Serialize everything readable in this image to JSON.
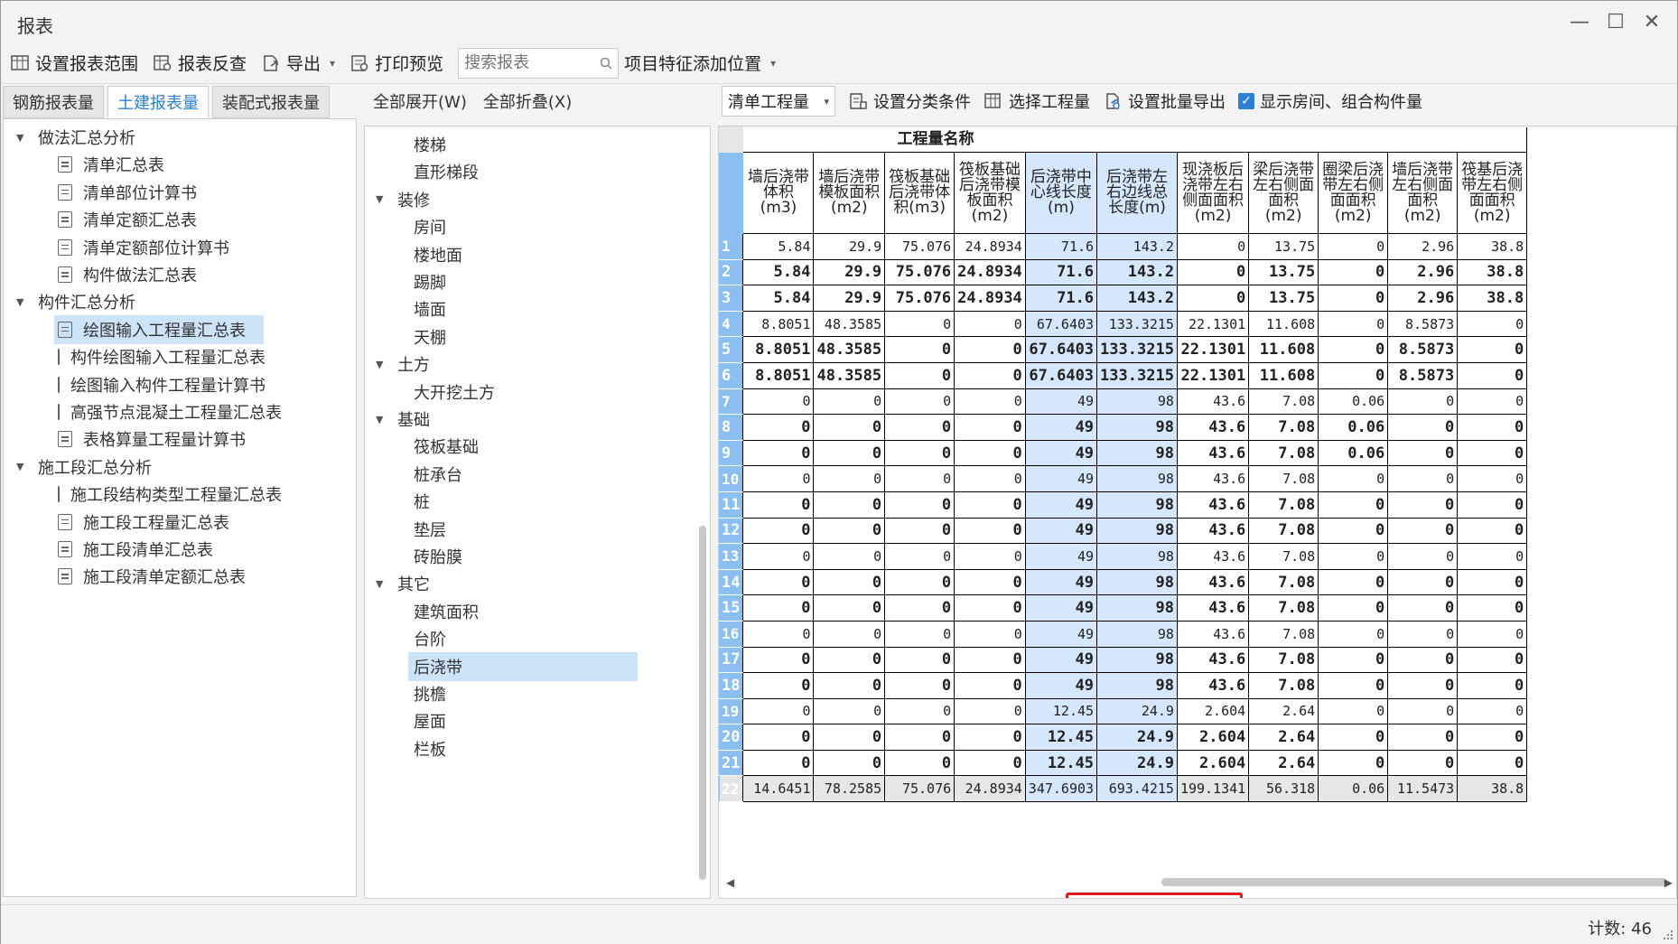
{
  "window": {
    "title": "报表"
  },
  "toolbar": {
    "set_range": "设置报表范围",
    "reverse_check": "报表反查",
    "export": "导出",
    "print_preview": "打印预览",
    "search_placeholder": "搜索报表",
    "feature_position": "项目特征添加位置"
  },
  "left": {
    "tabs": [
      "钢筋报表量",
      "土建报表量",
      "装配式报表量"
    ],
    "active_tab": 1,
    "tree": [
      {
        "label": "做法汇总分析",
        "level": 0,
        "type": "group"
      },
      {
        "label": "清单汇总表",
        "level": 1,
        "type": "doc"
      },
      {
        "label": "清单部位计算书",
        "level": 1,
        "type": "doc"
      },
      {
        "label": "清单定额汇总表",
        "level": 1,
        "type": "doc"
      },
      {
        "label": "清单定额部位计算书",
        "level": 1,
        "type": "doc"
      },
      {
        "label": "构件做法汇总表",
        "level": 1,
        "type": "doc"
      },
      {
        "label": "构件汇总分析",
        "level": 0,
        "type": "group"
      },
      {
        "label": "绘图输入工程量汇总表",
        "level": 1,
        "type": "doc",
        "selected": true
      },
      {
        "label": "构件绘图输入工程量汇总表",
        "level": 1,
        "type": "doc"
      },
      {
        "label": "绘图输入构件工程量计算书",
        "level": 1,
        "type": "doc"
      },
      {
        "label": "高强节点混凝土工程量汇总表",
        "level": 1,
        "type": "doc"
      },
      {
        "label": "表格算量工程量计算书",
        "level": 1,
        "type": "doc"
      },
      {
        "label": "施工段汇总分析",
        "level": 0,
        "type": "group"
      },
      {
        "label": "施工段结构类型工程量汇总表",
        "level": 1,
        "type": "doc"
      },
      {
        "label": "施工段工程量汇总表",
        "level": 1,
        "type": "doc"
      },
      {
        "label": "施工段清单汇总表",
        "level": 1,
        "type": "doc"
      },
      {
        "label": "施工段清单定额汇总表",
        "level": 1,
        "type": "doc"
      }
    ]
  },
  "middle": {
    "expand_all": "全部展开(W)",
    "collapse_all": "全部折叠(X)",
    "tree": [
      {
        "label": "楼梯",
        "level": 1
      },
      {
        "label": "直形梯段",
        "level": 1
      },
      {
        "label": "装修",
        "level": 0
      },
      {
        "label": "房间",
        "level": 1
      },
      {
        "label": "楼地面",
        "level": 1
      },
      {
        "label": "踢脚",
        "level": 1
      },
      {
        "label": "墙面",
        "level": 1
      },
      {
        "label": "天棚",
        "level": 1
      },
      {
        "label": "土方",
        "level": 0
      },
      {
        "label": "大开挖土方",
        "level": 1
      },
      {
        "label": "基础",
        "level": 0
      },
      {
        "label": "筏板基础",
        "level": 1
      },
      {
        "label": "桩承台",
        "level": 1
      },
      {
        "label": "桩",
        "level": 1
      },
      {
        "label": "垫层",
        "level": 1
      },
      {
        "label": "砖胎膜",
        "level": 1
      },
      {
        "label": "其它",
        "level": 0
      },
      {
        "label": "建筑面积",
        "level": 1
      },
      {
        "label": "台阶",
        "level": 1
      },
      {
        "label": "后浇带",
        "level": 1,
        "selected": true
      },
      {
        "label": "挑檐",
        "level": 1
      },
      {
        "label": "屋面",
        "level": 1
      },
      {
        "label": "栏板",
        "level": 1
      }
    ]
  },
  "right": {
    "dropdown_value": "清单工程量",
    "set_classification": "设置分类条件",
    "select_quantity": "选择工程量",
    "batch_export": "设置批量导出",
    "show_rooms": "显示房间、组合构件量",
    "show_rooms_checked": true,
    "group_header": "工程量名称",
    "columns": [
      "墙后浇带体积(m3)",
      "墙后浇带模板面积(m2)",
      "筏板基础后浇带体积(m3)",
      "筏板基础后浇带模板面积(m2)",
      "后浇带中心线长度(m)",
      "后浇带左右边线总长度(m)",
      "现浇板后浇带左右侧面面积(m2)",
      "梁后浇带左右侧面面积(m2)",
      "圈梁后浇带左右侧面面积(m2)",
      "墙后浇带左右侧面面积(m2)",
      "筏基后浇带左右侧面面积(m2)"
    ],
    "rows": [
      {
        "n": "1",
        "bold": false,
        "v": [
          "5.84",
          "29.9",
          "75.076",
          "24.8934",
          "71.6",
          "143.2",
          "0",
          "13.75",
          "0",
          "2.96",
          "38.8"
        ]
      },
      {
        "n": "2",
        "bold": true,
        "v": [
          "5.84",
          "29.9",
          "75.076",
          "24.8934",
          "71.6",
          "143.2",
          "0",
          "13.75",
          "0",
          "2.96",
          "38.8"
        ]
      },
      {
        "n": "3",
        "bold": true,
        "v": [
          "5.84",
          "29.9",
          "75.076",
          "24.8934",
          "71.6",
          "143.2",
          "0",
          "13.75",
          "0",
          "2.96",
          "38.8"
        ]
      },
      {
        "n": "4",
        "bold": false,
        "v": [
          "8.8051",
          "48.3585",
          "0",
          "0",
          "67.6403",
          "133.3215",
          "22.1301",
          "11.608",
          "0",
          "8.5873",
          "0"
        ]
      },
      {
        "n": "5",
        "bold": true,
        "v": [
          "8.8051",
          "48.3585",
          "0",
          "0",
          "67.6403",
          "133.3215",
          "22.1301",
          "11.608",
          "0",
          "8.5873",
          "0"
        ]
      },
      {
        "n": "6",
        "bold": true,
        "v": [
          "8.8051",
          "48.3585",
          "0",
          "0",
          "67.6403",
          "133.3215",
          "22.1301",
          "11.608",
          "0",
          "8.5873",
          "0"
        ]
      },
      {
        "n": "7",
        "bold": false,
        "v": [
          "0",
          "0",
          "0",
          "0",
          "49",
          "98",
          "43.6",
          "7.08",
          "0.06",
          "0",
          "0"
        ]
      },
      {
        "n": "8",
        "bold": true,
        "v": [
          "0",
          "0",
          "0",
          "0",
          "49",
          "98",
          "43.6",
          "7.08",
          "0.06",
          "0",
          "0"
        ]
      },
      {
        "n": "9",
        "bold": true,
        "v": [
          "0",
          "0",
          "0",
          "0",
          "49",
          "98",
          "43.6",
          "7.08",
          "0.06",
          "0",
          "0"
        ]
      },
      {
        "n": "10",
        "bold": false,
        "v": [
          "0",
          "0",
          "0",
          "0",
          "49",
          "98",
          "43.6",
          "7.08",
          "0",
          "0",
          "0"
        ]
      },
      {
        "n": "11",
        "bold": true,
        "v": [
          "0",
          "0",
          "0",
          "0",
          "49",
          "98",
          "43.6",
          "7.08",
          "0",
          "0",
          "0"
        ]
      },
      {
        "n": "12",
        "bold": true,
        "v": [
          "0",
          "0",
          "0",
          "0",
          "49",
          "98",
          "43.6",
          "7.08",
          "0",
          "0",
          "0"
        ]
      },
      {
        "n": "13",
        "bold": false,
        "v": [
          "0",
          "0",
          "0",
          "0",
          "49",
          "98",
          "43.6",
          "7.08",
          "0",
          "0",
          "0"
        ]
      },
      {
        "n": "14",
        "bold": true,
        "v": [
          "0",
          "0",
          "0",
          "0",
          "49",
          "98",
          "43.6",
          "7.08",
          "0",
          "0",
          "0"
        ]
      },
      {
        "n": "15",
        "bold": true,
        "v": [
          "0",
          "0",
          "0",
          "0",
          "49",
          "98",
          "43.6",
          "7.08",
          "0",
          "0",
          "0"
        ]
      },
      {
        "n": "16",
        "bold": false,
        "v": [
          "0",
          "0",
          "0",
          "0",
          "49",
          "98",
          "43.6",
          "7.08",
          "0",
          "0",
          "0"
        ]
      },
      {
        "n": "17",
        "bold": true,
        "v": [
          "0",
          "0",
          "0",
          "0",
          "49",
          "98",
          "43.6",
          "7.08",
          "0",
          "0",
          "0"
        ]
      },
      {
        "n": "18",
        "bold": true,
        "v": [
          "0",
          "0",
          "0",
          "0",
          "49",
          "98",
          "43.6",
          "7.08",
          "0",
          "0",
          "0"
        ]
      },
      {
        "n": "19",
        "bold": false,
        "v": [
          "0",
          "0",
          "0",
          "0",
          "12.45",
          "24.9",
          "2.604",
          "2.64",
          "0",
          "0",
          "0"
        ]
      },
      {
        "n": "20",
        "bold": true,
        "v": [
          "0",
          "0",
          "0",
          "0",
          "12.45",
          "24.9",
          "2.604",
          "2.64",
          "0",
          "0",
          "0"
        ]
      },
      {
        "n": "21",
        "bold": true,
        "v": [
          "0",
          "0",
          "0",
          "0",
          "12.45",
          "24.9",
          "2.604",
          "2.64",
          "0",
          "0",
          "0"
        ]
      },
      {
        "n": "22",
        "bold": false,
        "total": true,
        "v": [
          "14.6451",
          "78.2585",
          "75.076",
          "24.8934",
          "347.6903",
          "693.4215",
          "199.1341",
          "56.318",
          "0.06",
          "11.5473",
          "38.8"
        ]
      }
    ]
  },
  "status": {
    "count": "计数: 46"
  },
  "colors": {
    "accent": "#2e7fd6",
    "row_number_bg": "#8bbff0",
    "highlight_col": "#d5e8fb",
    "red_box": "#e01919",
    "selected_tree": "#cde3f8"
  }
}
